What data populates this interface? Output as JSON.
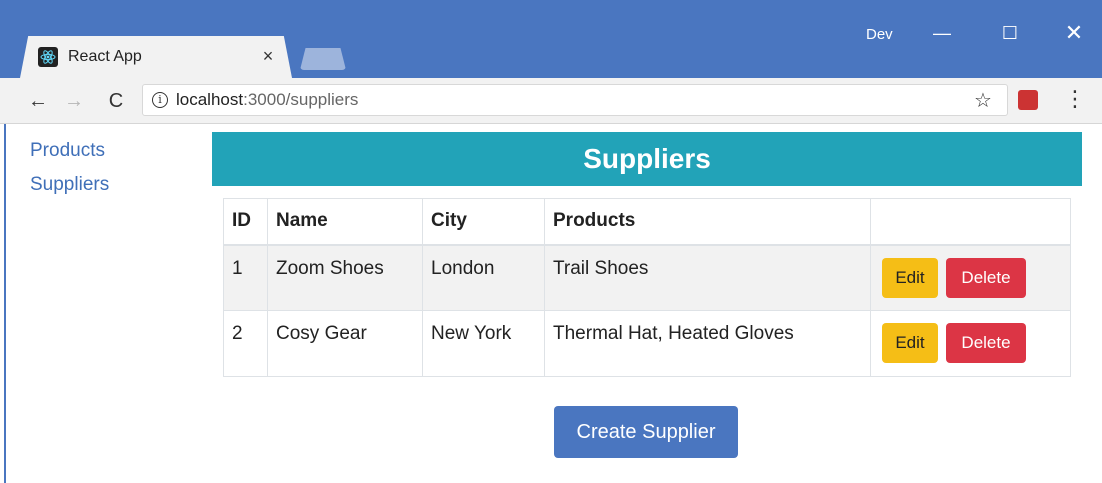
{
  "window": {
    "profile": "Dev",
    "minimize_glyph": "—",
    "maximize_glyph": "☐",
    "close_glyph": "✕"
  },
  "tab": {
    "title": "React App",
    "close_glyph": "×"
  },
  "toolbar": {
    "back_glyph": "←",
    "forward_glyph": "→",
    "reload_glyph": "C",
    "url_host": "localhost",
    "url_rest": ":3000/suppliers",
    "star_glyph": "☆",
    "menu_glyph": "⋮"
  },
  "sidenav": {
    "items": [
      {
        "label": "Products"
      },
      {
        "label": "Suppliers"
      }
    ]
  },
  "page": {
    "title": "Suppliers",
    "create_button": "Create Supplier"
  },
  "table": {
    "headers": [
      "ID",
      "Name",
      "City",
      "Products",
      ""
    ],
    "rows": [
      {
        "id": "1",
        "name": "Zoom Shoes",
        "city": "London",
        "products": "Trail Shoes",
        "edit": "Edit",
        "delete": "Delete"
      },
      {
        "id": "2",
        "name": "Cosy Gear",
        "city": "New York",
        "products": "Thermal Hat, Heated Gloves",
        "edit": "Edit",
        "delete": "Delete"
      }
    ]
  },
  "colors": {
    "chrome_accent": "#4a76c0",
    "header_bar": "#22a3b8",
    "edit_button": "#f5be16",
    "delete_button": "#dc3545",
    "link": "#3f6fb8"
  },
  "icons": [
    "react-favicon-icon",
    "info-icon",
    "star-icon",
    "extension-icon",
    "menu-icon"
  ]
}
